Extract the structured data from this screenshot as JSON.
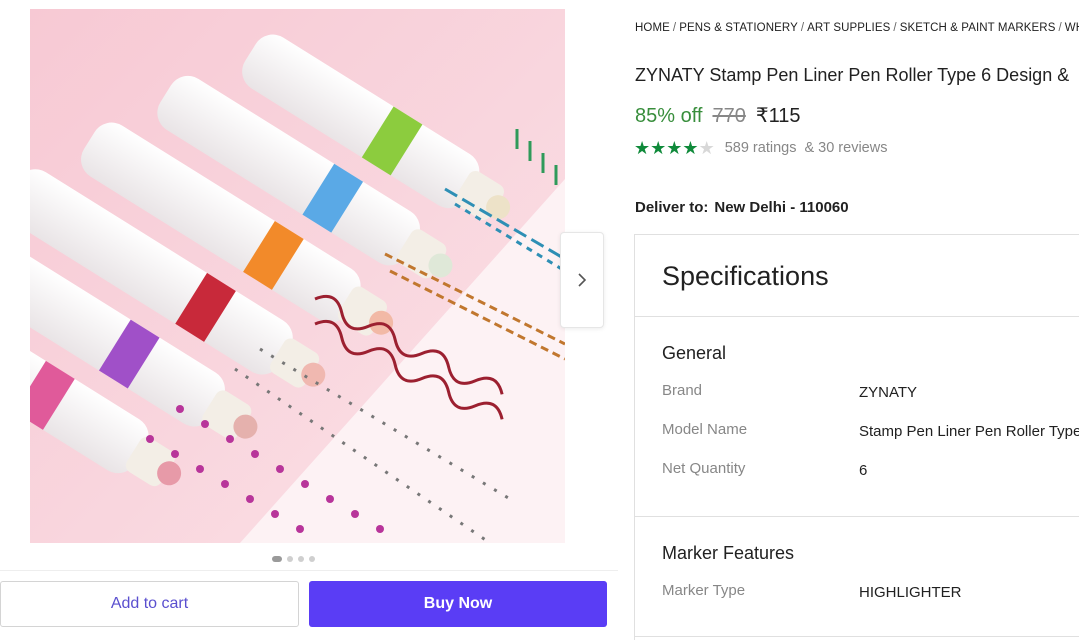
{
  "gallery": {
    "image_alt": "Colorful stamp roller pens drawing lines",
    "total_images": 4,
    "active_index": 0
  },
  "breadcrumb": [
    "HOME",
    "PENS & STATIONERY",
    "ART SUPPLIES",
    "SKETCH & PAINT MARKERS",
    "WHITEE"
  ],
  "product": {
    "title": "ZYNATY Stamp Pen Liner Pen Roller Type 6 Design &",
    "discount": "85% off",
    "mrp": "770",
    "price": "₹115",
    "rating_value": 4,
    "rating_max": 5,
    "ratings_text": "589 ratings",
    "reviews_text": "& 30 reviews"
  },
  "delivery": {
    "label": "Deliver to:",
    "location": "New Delhi - 110060"
  },
  "actions": {
    "add_to_cart": "Add to cart",
    "buy_now": "Buy Now"
  },
  "specifications": {
    "heading": "Specifications",
    "groups": [
      {
        "title": "General",
        "rows": [
          {
            "key": "Brand",
            "value": "ZYNATY"
          },
          {
            "key": "Model Name",
            "value": "Stamp Pen Liner Pen Roller Type"
          },
          {
            "key": "Net Quantity",
            "value": "6"
          }
        ]
      },
      {
        "title": "Marker Features",
        "rows": [
          {
            "key": "Marker Type",
            "value": "HIGHLIGHTER"
          }
        ]
      }
    ]
  },
  "colors": {
    "discount_green": "#388e3c",
    "star_green": "#0f8a3a",
    "buy_button": "#5a3df5",
    "cart_text": "#5a4fcf"
  }
}
